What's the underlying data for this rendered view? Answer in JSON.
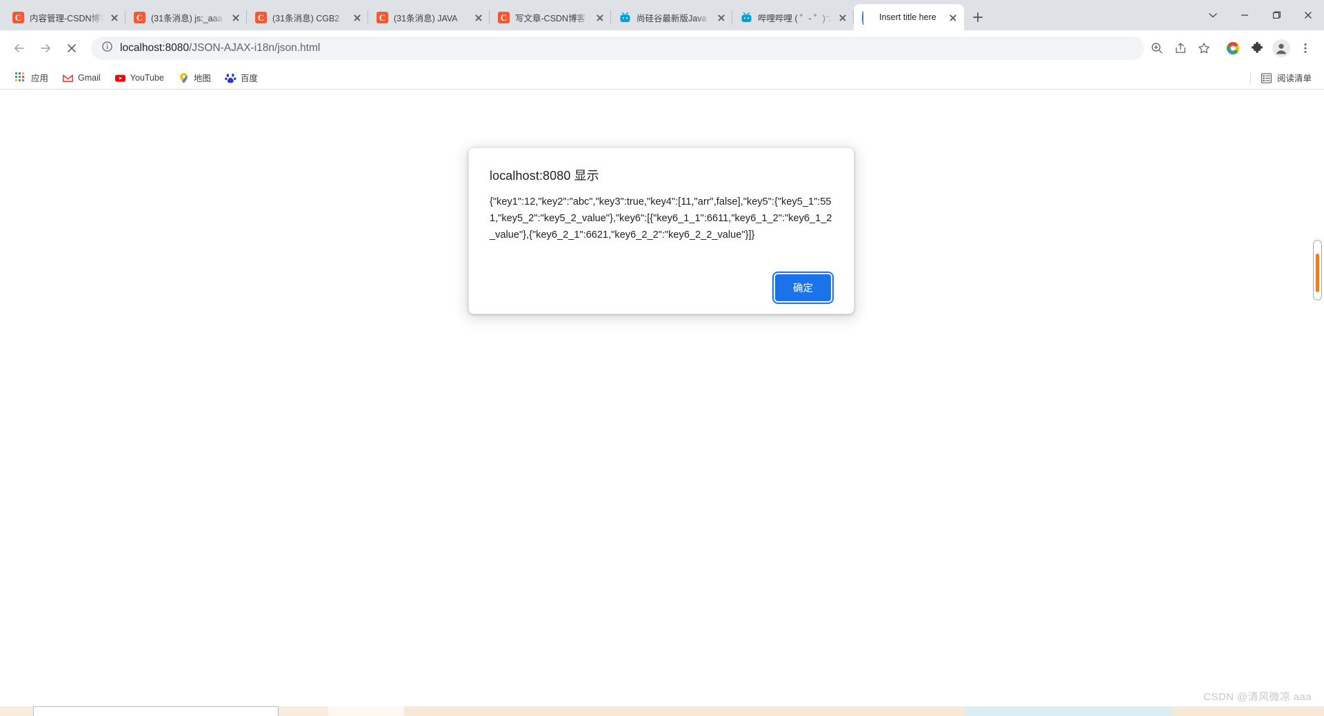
{
  "window": {
    "controls": [
      {
        "name": "tab-search-button",
        "icon": "chevron-down-icon"
      },
      {
        "name": "minimize-button",
        "icon": "minimize-icon"
      },
      {
        "name": "maximize-button",
        "icon": "maximize-icon"
      },
      {
        "name": "close-window-button",
        "icon": "close-icon"
      }
    ]
  },
  "tabs": [
    {
      "title": "内容管理-CSDN博客",
      "favicon": "csdn-icon",
      "active": false
    },
    {
      "title": "(31条消息) js:_aaa",
      "favicon": "csdn-icon",
      "active": false
    },
    {
      "title": "(31条消息) CGB2",
      "favicon": "csdn-icon",
      "active": false
    },
    {
      "title": "(31条消息) JAVA",
      "favicon": "csdn-icon",
      "active": false
    },
    {
      "title": "写文章-CSDN博客",
      "favicon": "csdn-icon",
      "active": false
    },
    {
      "title": "尚硅谷最新版Java",
      "favicon": "bilibili-icon",
      "active": false
    },
    {
      "title": "哔哩哔哩 ( ゜- ゜)つ",
      "favicon": "bilibili-icon",
      "active": false
    },
    {
      "title": "Insert title here",
      "favicon": "loading-spinner-icon",
      "active": true
    }
  ],
  "newtab_label": "+",
  "toolbar": {
    "back_label": "Back",
    "forward_label": "Forward",
    "stop_label": "Stop",
    "site_info_label": "Site information",
    "url_scheme": "localhost:8080",
    "url_path": "/JSON-AJAX-i18n/json.html",
    "url_full": "localhost:8080/JSON-AJAX-i18n/json.html",
    "right_icons": [
      {
        "name": "zoom-in-icon",
        "label": "Zoom"
      },
      {
        "name": "share-icon",
        "label": "Share"
      },
      {
        "name": "bookmark-star-icon",
        "label": "Bookmark"
      },
      {
        "name": "google-circle-icon",
        "label": "Google"
      },
      {
        "name": "extensions-puzzle-icon",
        "label": "Extensions"
      },
      {
        "name": "profile-avatar-icon",
        "label": "Profile"
      },
      {
        "name": "more-menu-icon",
        "label": "Menu"
      }
    ]
  },
  "bookmarks": {
    "items": [
      {
        "label": "应用",
        "icon": "apps-grid-icon"
      },
      {
        "label": "Gmail",
        "icon": "gmail-icon"
      },
      {
        "label": "YouTube",
        "icon": "youtube-icon"
      },
      {
        "label": "地图",
        "icon": "maps-pin-icon"
      },
      {
        "label": "百度",
        "icon": "baidu-icon"
      }
    ],
    "reading_list": {
      "label": "阅读清单",
      "icon": "reading-list-icon"
    }
  },
  "dialog": {
    "title": "localhost:8080 显示",
    "message": "{\"key1\":12,\"key2\":\"abc\",\"key3\":true,\"key4\":[11,\"arr\",false],\"key5\":{\"key5_1\":551,\"key5_2\":\"key5_2_value\"},\"key6\":[{\"key6_1_1\":6611,\"key6_1_2\":\"key6_1_2_value\"},{\"key6_2_1\":6621,\"key6_2_2\":\"key6_2_2_value\"}]}",
    "ok_label": "确定"
  },
  "watermark": "CSDN @清风微凉 aaa",
  "colors": {
    "accent_blue": "#1a73e8",
    "tabstrip_bg": "#dee1e6",
    "csdn_red": "#fc5531",
    "bilibili_blue": "#00a1d6",
    "scrollbar_thumb": "#f07c26"
  }
}
